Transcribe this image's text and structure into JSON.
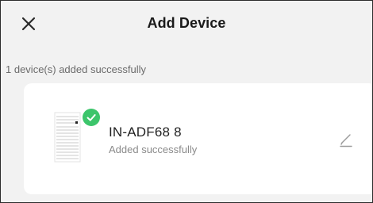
{
  "header": {
    "title": "Add Device",
    "close_icon": "close-icon"
  },
  "status": {
    "text": "1 device(s) added successfully"
  },
  "device": {
    "name": "IN-ADF68 8",
    "status": "Added successfully",
    "thumbnail_icon": "device-thumbnail",
    "badge_icon": "check-icon",
    "edit_icon": "pencil-icon"
  },
  "colors": {
    "background": "#f2f2f2",
    "card": "#ffffff",
    "success": "#3cc56b",
    "title": "#1a1a1a",
    "muted": "#8a8a8a"
  }
}
